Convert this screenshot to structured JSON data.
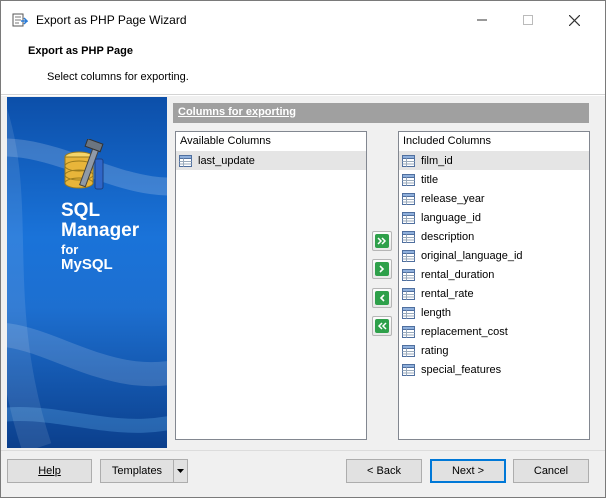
{
  "window": {
    "title": "Export as PHP Page Wizard"
  },
  "header": {
    "title": "Export as PHP Page",
    "subtitle": "Select columns for exporting."
  },
  "banner": {
    "line1": "SQL",
    "line2": "Manager",
    "line3": "for",
    "line4": "MySQL"
  },
  "group": {
    "title": "Columns for exporting"
  },
  "available": {
    "caption": "Available Columns",
    "items": [
      "last_update"
    ]
  },
  "included": {
    "caption": "Included Columns",
    "items": [
      "film_id",
      "title",
      "release_year",
      "language_id",
      "description",
      "original_language_id",
      "rental_duration",
      "rental_rate",
      "length",
      "replacement_cost",
      "rating",
      "special_features"
    ]
  },
  "footer": {
    "help": "Help",
    "templates": "Templates",
    "back": "< Back",
    "next": "Next >",
    "cancel": "Cancel"
  },
  "colors": {
    "accent": "#0078d7",
    "banner": "#1a73d9",
    "arrow": "#2ea04a",
    "group_header": "#a0a0a0"
  },
  "icons": {
    "app": "export-wizard-icon",
    "column": "table-column-icon",
    "add_all": "double-chevron-right-icon",
    "add": "chevron-right-icon",
    "remove": "chevron-left-icon",
    "remove_all": "double-chevron-left-icon"
  }
}
